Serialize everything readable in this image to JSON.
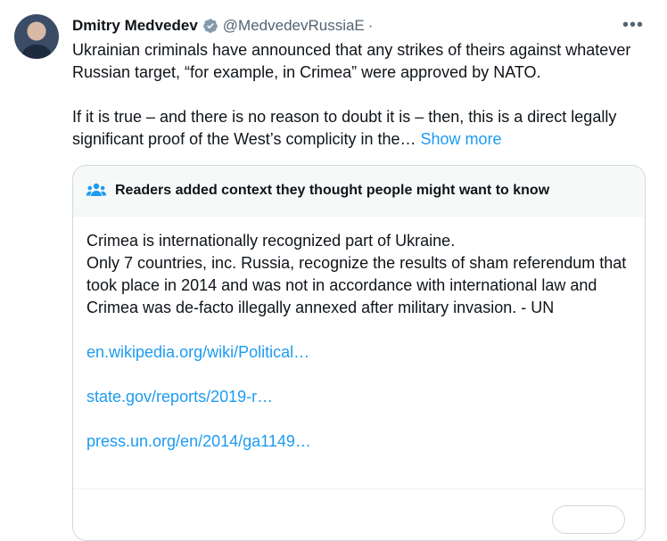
{
  "author": {
    "display_name": "Dmitry Medvedev",
    "handle": "@MedvedevRussiaE",
    "separator": "·",
    "avatar_icon": "profile-photo",
    "verified_icon": "verified-badge-icon",
    "verified_color": "#829aab"
  },
  "tweet": {
    "paragraph1": "Ukrainian criminals have announced that any strikes of theirs against whatever Russian target, “for example, in Crimea” were approved by NATO.",
    "paragraph2": "If it is true – and there is no reason to doubt it is – then, this is a direct legally significant proof of the West’s complicity in the…",
    "show_more": "Show more",
    "more_icon": "more-options-icon"
  },
  "community_note": {
    "header": "Readers added context they thought people might want to know",
    "header_icon": "people-icon",
    "icon_color": "#1d9bf0",
    "body_line1": "Crimea is internationally recognized part of Ukraine.",
    "body_line2": "Only 7 countries, inc. Russia, recognize the results of sham referendum that took place in 2014 and was not in accordance with international law and Crimea was de-facto illegally annexed after military invasion. - UN",
    "links": [
      "en.wikipedia.org/wiki/Political…",
      "state.gov/reports/2019-r…",
      "press.un.org/en/2014/ga1149…"
    ]
  },
  "colors": {
    "text": "#0f1419",
    "secondary": "#536471",
    "link": "#1d9bf0",
    "border": "#cfd9de"
  }
}
